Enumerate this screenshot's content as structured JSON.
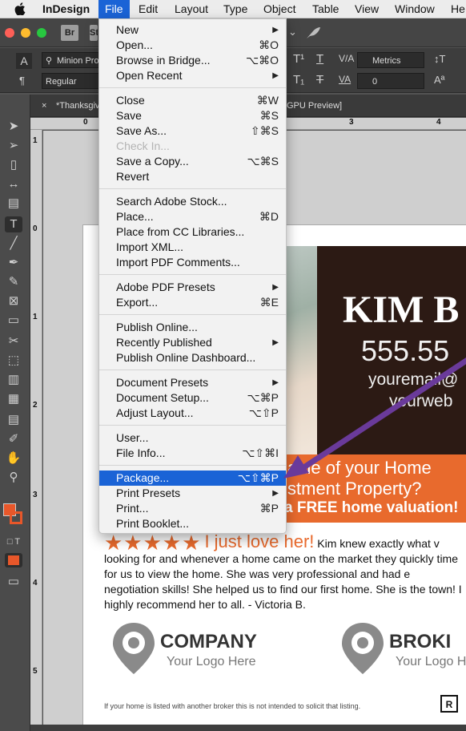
{
  "menubar": {
    "app_name": "InDesign",
    "items": [
      "File",
      "Edit",
      "Layout",
      "Type",
      "Object",
      "Table",
      "View",
      "Window",
      "He"
    ]
  },
  "appbar": {
    "bridge_badge": "Br",
    "stock_badge": "St"
  },
  "control": {
    "font_family": "Minion Pro",
    "font_style": "Regular",
    "kerning": "Metrics",
    "tracking": "0"
  },
  "document": {
    "tab_title": "*Thanksgiv",
    "tab_suffix": "GPU Preview]",
    "close_glyph": "×"
  },
  "rulers": {
    "top": [
      "0",
      "3",
      "4"
    ],
    "left": [
      "1",
      "0",
      "1",
      "2",
      "3",
      "4",
      "5"
    ]
  },
  "file_menu": {
    "groups": [
      [
        {
          "label": "New",
          "submenu": true
        },
        {
          "label": "Open...",
          "shortcut": "⌘O"
        },
        {
          "label": "Browse in Bridge...",
          "shortcut": "⌥⌘O"
        },
        {
          "label": "Open Recent",
          "submenu": true
        }
      ],
      [
        {
          "label": "Close",
          "shortcut": "⌘W"
        },
        {
          "label": "Save",
          "shortcut": "⌘S"
        },
        {
          "label": "Save As...",
          "shortcut": "⇧⌘S"
        },
        {
          "label": "Check In...",
          "disabled": true
        },
        {
          "label": "Save a Copy...",
          "shortcut": "⌥⌘S"
        },
        {
          "label": "Revert"
        }
      ],
      [
        {
          "label": "Search Adobe Stock..."
        },
        {
          "label": "Place...",
          "shortcut": "⌘D"
        },
        {
          "label": "Place from CC Libraries..."
        },
        {
          "label": "Import XML..."
        },
        {
          "label": "Import PDF Comments..."
        }
      ],
      [
        {
          "label": "Adobe PDF Presets",
          "submenu": true
        },
        {
          "label": "Export...",
          "shortcut": "⌘E"
        }
      ],
      [
        {
          "label": "Publish Online..."
        },
        {
          "label": "Recently Published",
          "submenu": true
        },
        {
          "label": "Publish Online Dashboard..."
        }
      ],
      [
        {
          "label": "Document Presets",
          "submenu": true
        },
        {
          "label": "Document Setup...",
          "shortcut": "⌥⌘P"
        },
        {
          "label": "Adjust Layout...",
          "shortcut": "⌥⇧P"
        }
      ],
      [
        {
          "label": "User..."
        },
        {
          "label": "File Info...",
          "shortcut": "⌥⇧⌘I"
        }
      ],
      [
        {
          "label": "Package...",
          "shortcut": "⌥⇧⌘P",
          "highlighted": true
        },
        {
          "label": "Print Presets",
          "submenu": true
        },
        {
          "label": "Print...",
          "shortcut": "⌘P"
        },
        {
          "label": "Print Booklet..."
        }
      ]
    ],
    "submenu_glyph": "▶"
  },
  "flyer": {
    "agent_name": "KIM B",
    "phone": "555.55",
    "email": "youremail@",
    "website": "yourweb",
    "cta_line1": "alue of  your Home",
    "cta_line2": "stment Property?",
    "cta_line3": "a FREE home valuation!",
    "stars": "★★★★★",
    "review_headline": "I just love her!",
    "review_body": "Kim knew exactly what v looking for and whenever a home came on the market they quickly time for us to view the home. She was very professional and had e negotiation skills! She helped us to find our first home. She is the town! I highly recommend her to all. - Victoria B.",
    "logo1_title": "COMPANY",
    "logo1_sub": "Your Logo Here",
    "logo2_title": "BROKI",
    "logo2_sub": "Your Logo H",
    "disclaimer": "If your home is listed with another broker this is not intended to solicit that listing."
  },
  "colors": {
    "menu_highlight": "#1a63d6",
    "accent_orange": "#e86a2d",
    "dark_panel": "#2c1a14",
    "arrow": "#6a3a9a"
  }
}
